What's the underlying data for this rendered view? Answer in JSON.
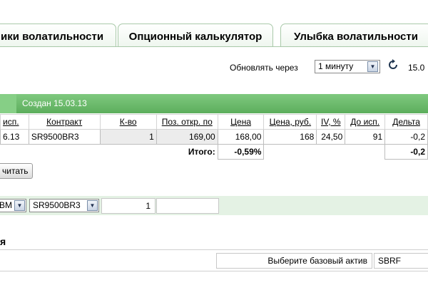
{
  "tabs": [
    {
      "label": "ики волатильности"
    },
    {
      "label": "Опционный калькулятор"
    },
    {
      "label": "Улыбка волатильности"
    }
  ],
  "refresh": {
    "label": "Обновлять через",
    "interval_value": "1 минуту",
    "date_text": "15.0"
  },
  "portfolio": {
    "created_label": "Создан 15.03.13",
    "columns": [
      "исп.",
      "Контракт",
      "К-во",
      "Поз. откр. по",
      "Цена",
      "Цена, руб.",
      "IV, %",
      "До исп.",
      "Дельта"
    ],
    "rows": [
      [
        "6.13",
        "SR9500BR3",
        "1",
        "169,00",
        "168,00",
        "168",
        "24,50",
        "91",
        "-0,2"
      ]
    ],
    "totals": {
      "label": "Итого:",
      "price_change": "-0,59%",
      "delta": "-0,2"
    },
    "recalc_button": "читать"
  },
  "add_row": {
    "series_value": "BM",
    "contract_value": "SR9500BR3",
    "quantity_value": "1"
  },
  "section": {
    "title": "я",
    "base_asset_label": "Выберите базовый актив",
    "base_asset_value": "SBRF"
  },
  "colors": {
    "accent_green": "#6cbc6c",
    "light_green": "#e4f2e4",
    "tab_border": "#a9c9a9"
  },
  "icons": {
    "refresh": "refresh-icon",
    "dropdown": "chevron-down-icon"
  }
}
